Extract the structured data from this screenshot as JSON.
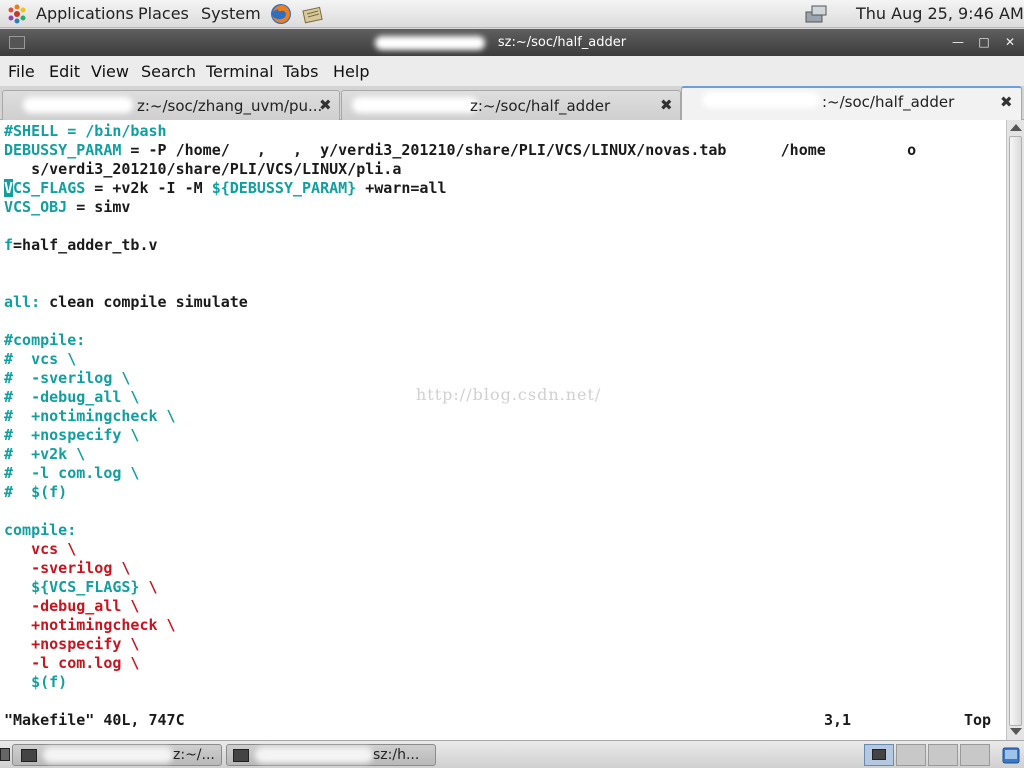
{
  "top_panel": {
    "menus": [
      "Applications",
      "Places",
      "System"
    ],
    "clock": "Thu Aug 25,  9:46 AM"
  },
  "window": {
    "title": "sz:~/soc/half_adder",
    "controls": [
      "minimize",
      "maximize",
      "close"
    ]
  },
  "menubar": [
    "File",
    "Edit",
    "View",
    "Search",
    "Terminal",
    "Tabs",
    "Help"
  ],
  "tabs": [
    {
      "label": "z:~/soc/zhang_uvm/pu...",
      "active": false
    },
    {
      "label": "z:~/soc/half_adder",
      "active": false
    },
    {
      "label": ":~/soc/half_adder",
      "active": true
    }
  ],
  "terminal": {
    "lines": [
      {
        "segments": [
          {
            "text": "#SHELL = /bin/bash",
            "color": "cyan"
          }
        ]
      },
      {
        "segments": [
          {
            "text": "DEBUSSY_PARAM",
            "color": "cyan"
          },
          {
            "text": " = -P /home/   ,   ,  y/verdi3_201210/share/PLI/VCS/LINUX/novas.tab      /home         o",
            "color": "default"
          }
        ]
      },
      {
        "segments": [
          {
            "text": "   s/verdi3_201210/share/PLI/VCS/LINUX/pli.a",
            "color": "default"
          }
        ]
      },
      {
        "segments": [
          {
            "text": "V",
            "color": "cursor"
          },
          {
            "text": "CS_FLAGS",
            "color": "cyan"
          },
          {
            "text": " = +v2k -I -M ",
            "color": "default"
          },
          {
            "text": "${DEBUSSY_PARAM}",
            "color": "cyan"
          },
          {
            "text": " +warn=all",
            "color": "default"
          }
        ]
      },
      {
        "segments": [
          {
            "text": "VCS_OBJ",
            "color": "cyan"
          },
          {
            "text": " = simv",
            "color": "default"
          }
        ]
      },
      {
        "segments": []
      },
      {
        "segments": [
          {
            "text": "f",
            "color": "cyan"
          },
          {
            "text": "=half_adder_tb.v",
            "color": "default"
          }
        ]
      },
      {
        "segments": []
      },
      {
        "segments": []
      },
      {
        "segments": [
          {
            "text": "all:",
            "color": "cyan"
          },
          {
            "text": " clean compile simulate",
            "color": "default"
          }
        ]
      },
      {
        "segments": []
      },
      {
        "segments": [
          {
            "text": "#compile:",
            "color": "cyan"
          }
        ]
      },
      {
        "segments": [
          {
            "text": "#  vcs \\",
            "color": "cyan"
          }
        ]
      },
      {
        "segments": [
          {
            "text": "#  -sverilog \\",
            "color": "cyan"
          }
        ]
      },
      {
        "segments": [
          {
            "text": "#  -debug_all \\",
            "color": "cyan"
          }
        ]
      },
      {
        "segments": [
          {
            "text": "#  +notimingcheck \\",
            "color": "cyan"
          }
        ]
      },
      {
        "segments": [
          {
            "text": "#  +nospecify \\",
            "color": "cyan"
          }
        ]
      },
      {
        "segments": [
          {
            "text": "#  +v2k \\",
            "color": "cyan"
          }
        ]
      },
      {
        "segments": [
          {
            "text": "#  -l com.log \\",
            "color": "cyan"
          }
        ]
      },
      {
        "segments": [
          {
            "text": "#  $(f)",
            "color": "cyan"
          }
        ]
      },
      {
        "segments": []
      },
      {
        "segments": [
          {
            "text": "compile:",
            "color": "cyan"
          }
        ]
      },
      {
        "segments": [
          {
            "text": "   vcs \\",
            "color": "red"
          }
        ]
      },
      {
        "segments": [
          {
            "text": "   -sverilog \\",
            "color": "red"
          }
        ]
      },
      {
        "segments": [
          {
            "text": "   ",
            "color": "default"
          },
          {
            "text": "${VCS_FLAGS}",
            "color": "cyan"
          },
          {
            "text": " \\",
            "color": "red"
          }
        ]
      },
      {
        "segments": [
          {
            "text": "   -debug_all \\",
            "color": "red"
          }
        ]
      },
      {
        "segments": [
          {
            "text": "   +notimingcheck \\",
            "color": "red"
          }
        ]
      },
      {
        "segments": [
          {
            "text": "   +nospecify \\",
            "color": "red"
          }
        ]
      },
      {
        "segments": [
          {
            "text": "   -l com.log \\",
            "color": "red"
          }
        ]
      },
      {
        "segments": [
          {
            "text": "   ",
            "color": "default"
          },
          {
            "text": "$(f)",
            "color": "cyan"
          }
        ]
      }
    ],
    "status_file": "\"Makefile\" 40L, 747C",
    "status_pos": "3,1",
    "status_scroll": "Top",
    "watermark": "http://blog.csdn.net/"
  },
  "taskbar": {
    "tasks": [
      {
        "label": "z:~/...",
        "active": false
      },
      {
        "label": "sz:/h...",
        "active": false
      }
    ],
    "workspaces": 4
  },
  "colors": {
    "cyan": "#119f9f",
    "red": "#c8141e",
    "default": "#1a1a1a"
  }
}
